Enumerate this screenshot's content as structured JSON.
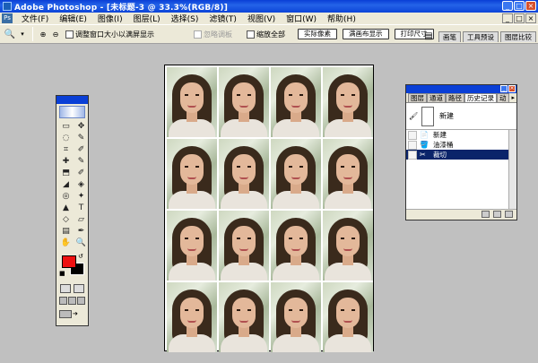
{
  "window": {
    "title": "Adobe Photoshop - [未标题-3 @ 33.3%(RGB/8)]",
    "controls": [
      "_",
      "□",
      "×"
    ]
  },
  "menubar": {
    "items": [
      "文件(F)",
      "编辑(E)",
      "图像(I)",
      "图层(L)",
      "选择(S)",
      "滤镜(T)",
      "视图(V)",
      "窗口(W)",
      "帮助(H)"
    ],
    "doc_controls": [
      "_",
      "□",
      "×"
    ]
  },
  "options": {
    "resize_windows_label": "调整窗口大小以满屏显示",
    "ignore_palettes_label": "忽略调板",
    "zoom_all_label": "缩放全部",
    "actual_pixels": "实际像素",
    "fit_screen": "满画布显示",
    "print_size": "打印尺寸",
    "well_tabs": [
      "画笔",
      "工具预设",
      "图层比较"
    ]
  },
  "document": {
    "rows": 4,
    "cols": 4
  },
  "toolbox": {
    "tools": [
      "▭",
      "✥",
      "◌",
      "✎",
      "⌗",
      "✐",
      "✚",
      "✎",
      "⬒",
      "✐",
      "◢",
      "◈",
      "◎",
      "✦",
      "▲",
      "T",
      "◇",
      "▱",
      "▤",
      "✒",
      "✋",
      "🔍"
    ],
    "fg_color": "#ee1111",
    "bg_color": "#000000"
  },
  "history": {
    "tabs": [
      "图层",
      "通道",
      "路径",
      "历史记录",
      "动"
    ],
    "active_tab": "历史记录",
    "snapshot_label": "新建",
    "items": [
      {
        "label": "新建",
        "icon": "📄"
      },
      {
        "label": "油漆桶",
        "icon": "🪣"
      },
      {
        "label": "裁切",
        "icon": "✂"
      }
    ],
    "active_item": "裁切"
  }
}
